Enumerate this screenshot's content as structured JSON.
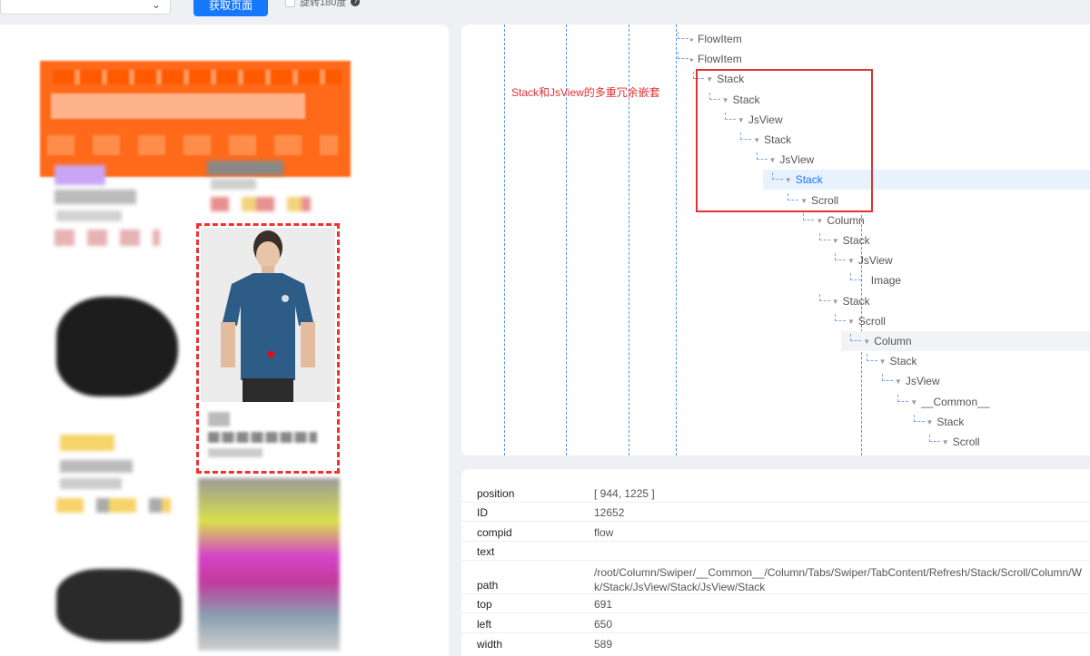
{
  "toolbar": {
    "fetch_label": "获取页面",
    "rotate_label": "旋转180度",
    "help_glyph": "?"
  },
  "annotation": {
    "text": "Stack和JsView的多重冗余嵌套",
    "color": "#e03030"
  },
  "tree": {
    "nodes": [
      {
        "label": "FlowItem",
        "depth": 0,
        "expanded": false
      },
      {
        "label": "FlowItem",
        "depth": 0,
        "expanded": false
      },
      {
        "label": "Stack",
        "depth": 1,
        "expanded": true
      },
      {
        "label": "Stack",
        "depth": 2,
        "expanded": true
      },
      {
        "label": "JsView",
        "depth": 3,
        "expanded": true
      },
      {
        "label": "Stack",
        "depth": 4,
        "expanded": true
      },
      {
        "label": "JsView",
        "depth": 5,
        "expanded": true
      },
      {
        "label": "Stack",
        "depth": 6,
        "expanded": true,
        "selected": true
      },
      {
        "label": "Scroll",
        "depth": 7,
        "expanded": true
      },
      {
        "label": "Column",
        "depth": 8,
        "expanded": true
      },
      {
        "label": "Stack",
        "depth": 9,
        "expanded": true
      },
      {
        "label": "JsView",
        "depth": 10,
        "expanded": true
      },
      {
        "label": "Image",
        "depth": 11,
        "expanded": false
      },
      {
        "label": "Stack",
        "depth": 9,
        "expanded": true
      },
      {
        "label": "Scroll",
        "depth": 10,
        "expanded": true
      },
      {
        "label": "Column",
        "depth": 11,
        "expanded": true,
        "hover": true
      },
      {
        "label": "Stack",
        "depth": 12,
        "expanded": true
      },
      {
        "label": "JsView",
        "depth": 13,
        "expanded": true
      },
      {
        "label": "__Common__",
        "depth": 14,
        "expanded": true
      },
      {
        "label": "Stack",
        "depth": 15,
        "expanded": true
      },
      {
        "label": "Scroll",
        "depth": 16,
        "expanded": true
      }
    ]
  },
  "properties": {
    "position": {
      "key": "position",
      "value": "[ 944, 1225 ]"
    },
    "id": {
      "key": "ID",
      "value": "12652"
    },
    "compid": {
      "key": "compid",
      "value": "flow"
    },
    "text": {
      "key": "text",
      "value": ""
    },
    "path": {
      "key": "path",
      "value": "/root/Column/Swiper/__Common__/Column/Tabs/Swiper/TabContent/Refresh/Stack/Scroll/Column/W",
      "value2": "k/Stack/JsView/Stack/JsView/Stack"
    },
    "top": {
      "key": "top",
      "value": "691"
    },
    "left": {
      "key": "left",
      "value": "650"
    },
    "width": {
      "key": "width",
      "value": "589"
    }
  },
  "colors": {
    "accent": "#1677ff",
    "annotation_red": "#e03030",
    "header_orange": "#ff6a1a",
    "selected_row_bg": "#e8f2fd"
  }
}
